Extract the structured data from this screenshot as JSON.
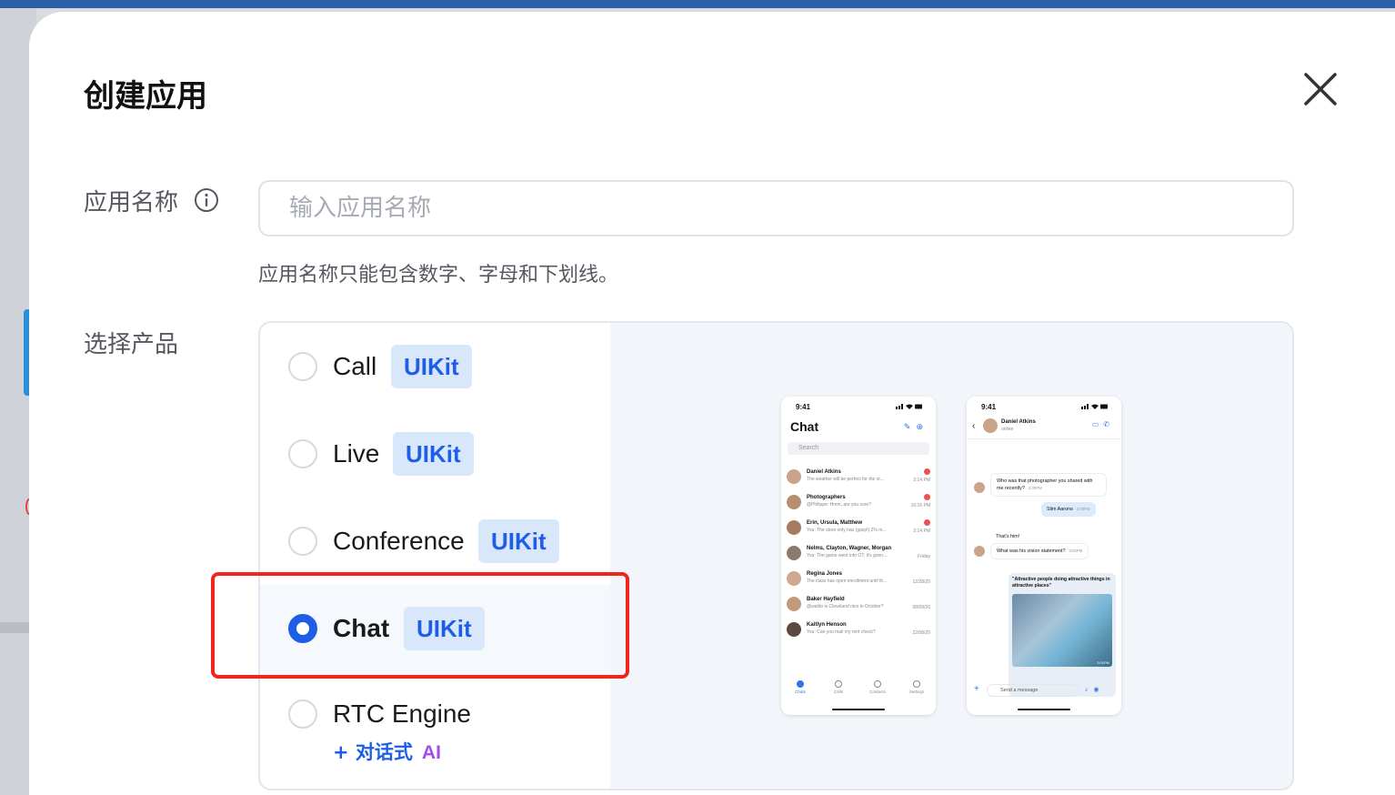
{
  "dialog": {
    "title": "创建应用",
    "close_label": "×"
  },
  "form": {
    "name_label": "应用名称",
    "name_placeholder": "输入应用名称",
    "name_value": "",
    "name_hint": "应用名称只能包含数字、字母和下划线。",
    "product_label": "选择产品"
  },
  "products": [
    {
      "label": "Call",
      "badge": "UIKit",
      "selected": false
    },
    {
      "label": "Live",
      "badge": "UIKit",
      "selected": false
    },
    {
      "label": "Conference",
      "badge": "UIKit",
      "selected": false
    },
    {
      "label": "Chat",
      "badge": "UIKit",
      "selected": true
    },
    {
      "label": "RTC Engine",
      "subtag": "+ 对话式",
      "subtag_ai": "AI",
      "selected": false
    }
  ],
  "preview": {
    "list_screen": {
      "time": "9:41",
      "title": "Chat",
      "search_placeholder": "Search",
      "conversations": [
        {
          "name": "Daniel Atkins",
          "message": "The weather will be perfect for the st...",
          "time": "2:14 PM",
          "unread": true
        },
        {
          "name": "Photographers",
          "message": "@Philippe: Hmm, are you sure?",
          "time": "10:16 PM",
          "unread": true
        },
        {
          "name": "Erin, Ursula, Matthew",
          "message": "You: The store only has (gasp!) 2% m...",
          "time": "2:14 PM",
          "unread": true
        },
        {
          "name": "Nelms, Clayton, Wagner, Morgan",
          "message": "You: The game went into OT, it's gonn...",
          "time": "Friday",
          "unread": false
        },
        {
          "name": "Regina Jones",
          "message": "The class has open enrollment until th...",
          "time": "12/28/20",
          "unread": false
        },
        {
          "name": "Baker Hayfield",
          "message": "@waldo is Cleveland nice in October?",
          "time": "08/09/20",
          "unread": false
        },
        {
          "name": "Kaitlyn Henson",
          "message": "You: Can you mail my rent check?",
          "time": "22/08/20",
          "unread": false
        }
      ],
      "tabs": [
        "Chats",
        "Calls",
        "Contacts",
        "Settings"
      ]
    },
    "chat_screen": {
      "time": "9:41",
      "contact_name": "Daniel Atkins",
      "contact_status": "online",
      "messages": [
        {
          "text": "Who was that photographer you shared with me recently?",
          "time": "3:00PM",
          "direction": "in"
        },
        {
          "text": "Slim Aarons",
          "time": "3:00PM",
          "direction": "out"
        },
        {
          "text": "That's him!",
          "time": "",
          "direction": "in"
        },
        {
          "text": "What was his vision statement?",
          "time": "3:00PM",
          "direction": "in"
        }
      ],
      "image_caption": "\"Attractive people doing attractive things in attractive places\"",
      "image_time": "3:01PM",
      "composer_placeholder": "Send a message"
    }
  },
  "colors": {
    "primary": "#1e5ee6",
    "badge_bg": "#d9e7fb",
    "highlight": "#f0261c",
    "ai": "#a24cf0"
  }
}
